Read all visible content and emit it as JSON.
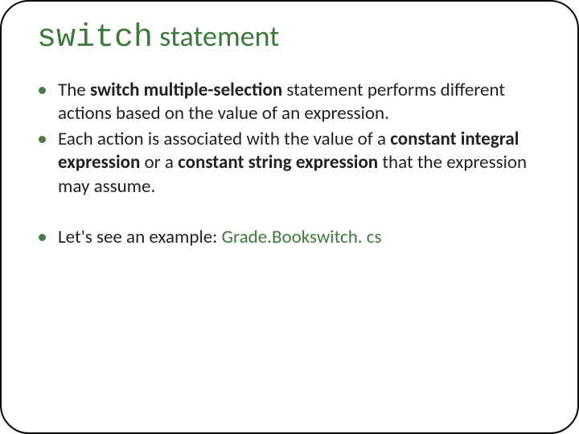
{
  "title": {
    "code": "switch",
    "rest": " statement"
  },
  "bullets": {
    "b1": {
      "p1": "The ",
      "bold1": "switch multiple-selection",
      "p2": " statement performs different actions based on the value of an expression."
    },
    "b2": {
      "p1": "Each action is associated with the value of a ",
      "bold1": "constant integral expression",
      "p2": " or a ",
      "bold2": "constant string expression",
      "p3": " that the expression may assume."
    },
    "b3": {
      "p1": "Let's see an example: ",
      "link": "Grade.Bookswitch. cs"
    }
  },
  "colors": {
    "accent": "#3c7a3c",
    "bullet": "#4a7a46",
    "text": "#222222"
  }
}
